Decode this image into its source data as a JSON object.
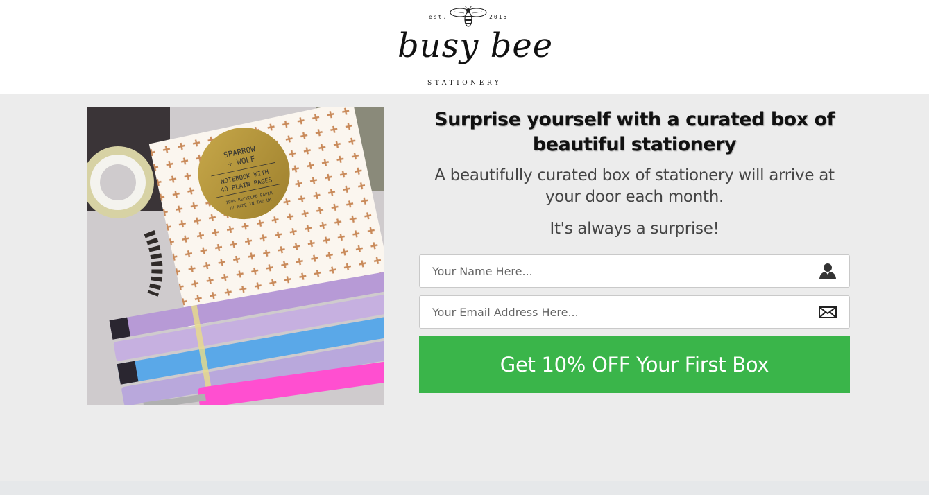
{
  "logo": {
    "est_left": "est.",
    "est_right": "2015",
    "script": "busy bee",
    "sub": "STATIONERY"
  },
  "hero_image": {
    "label_line1": "SPARROW",
    "label_line2": "+ WOLF",
    "label_line3": "NOTEBOOK WITH",
    "label_line4": "40 PLAIN PAGES",
    "label_line5": "100% RECYCLED PAPER",
    "label_line6": "// MADE IN THE UK"
  },
  "headline": "Surprise yourself with a curated box of beautiful stationery",
  "subtext": "A beautifully curated box of stationery will arrive at your door each month.",
  "surprise": "It's always a surprise!",
  "form": {
    "name_placeholder": "Your Name Here...",
    "name_icon": "user-icon",
    "email_placeholder": "Your Email Address Here...",
    "email_icon": "envelope-icon",
    "cta_label": "Get 10% OFF Your First Box",
    "cta_color": "#3ab54a"
  }
}
